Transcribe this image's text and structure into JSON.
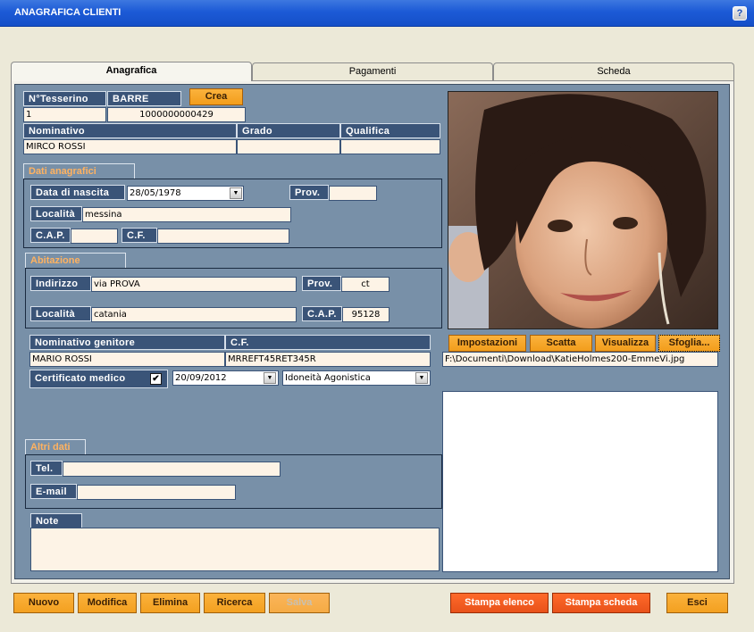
{
  "window": {
    "title": "ANAGRAFICA CLIENTI",
    "help": "?"
  },
  "tabs": [
    {
      "label": "Anagrafica",
      "active": true
    },
    {
      "label": "Pagamenti",
      "active": false
    },
    {
      "label": "Scheda",
      "active": false
    }
  ],
  "member": {
    "tessera_label": "N°Tesserino",
    "tessera_value": "1",
    "barre_label": "BARRE",
    "barre_value": "1000000000429",
    "crea_label": "Crea",
    "nominativo_label": "Nominativo",
    "nominativo_value": "MIRCO ROSSI",
    "grado_label": "Grado",
    "grado_value": "",
    "qualifica_label": "Qualifica",
    "qualifica_value": ""
  },
  "dati_anagrafici": {
    "title": "Dati anagrafici",
    "nascita_label": "Data di nascita",
    "nascita_value": "28/05/1978",
    "prov_label": "Prov.",
    "prov_value": "",
    "localita_label": "Località",
    "localita_value": "messina",
    "cap_label": "C.A.P.",
    "cap_value": "",
    "cf_label": "C.F.",
    "cf_value": ""
  },
  "abitazione": {
    "title": "Abitazione",
    "indirizzo_label": "Indirizzo",
    "indirizzo_value": "via PROVA",
    "prov_label": "Prov.",
    "prov_value": "ct",
    "localita_label": "Località",
    "localita_value": "catania",
    "cap_label": "C.A.P.",
    "cap_value": "95128"
  },
  "genitore": {
    "nominativo_label": "Nominativo genitore",
    "nominativo_value": "MARIO ROSSI",
    "cf_label": "C.F.",
    "cf_value": "MRREFT45RET345R"
  },
  "certificato": {
    "label": "Certificato medico",
    "checked": true,
    "check_mark": "✔",
    "date_value": "20/09/2012",
    "type_value": "Idoneità Agonistica"
  },
  "altri_dati": {
    "title": "Altri dati",
    "tel_label": "Tel.",
    "tel_value": "",
    "email_label": "E-mail",
    "email_value": ""
  },
  "note": {
    "label": "Note",
    "value": ""
  },
  "photo": {
    "buttons": [
      "Impostazioni",
      "Scatta",
      "Visualizza",
      "Sfoglia..."
    ],
    "path": "F:\\Documenti\\Download\\KatieHolmes200-EmmeVi.jpg"
  },
  "footer": {
    "nuovo": "Nuovo",
    "modifica": "Modifica",
    "elimina": "Elimina",
    "ricerca": "Ricerca",
    "salva": "Salva",
    "stampa_elenco": "Stampa elenco",
    "stampa_scheda": "Stampa scheda",
    "esci": "Esci"
  },
  "dropdown_glyph": "▼",
  "colors": {
    "label_bg": "#3a5478",
    "panel_bg": "#7890a8",
    "field_bg": "#fdf3e6",
    "group_title": "#ffb260",
    "orange_button": "#f29d1c",
    "red_button": "#e8521a"
  }
}
